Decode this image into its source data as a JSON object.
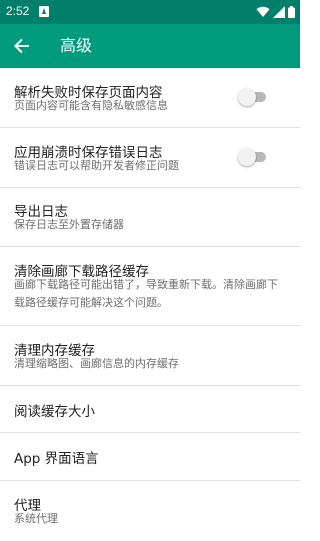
{
  "status_bar": {
    "time": "2:52",
    "icons": [
      "notification-a-icon",
      "wifi-icon",
      "cell-signal-icon",
      "battery-icon"
    ]
  },
  "app_bar": {
    "back_icon": "arrow-left-icon",
    "title": "高级"
  },
  "items": [
    {
      "title": "解析失败时保存页面内容",
      "subtitle": "页面内容可能含有隐私敏感信息",
      "toggle": false
    },
    {
      "title": "应用崩溃时保存错误日志",
      "subtitle": "错误日志可以帮助开发者修正问题",
      "toggle": false
    },
    {
      "title": "导出日志",
      "subtitle": "保存日志至外置存储器"
    },
    {
      "title": "清除画廊下载路径缓存",
      "subtitle": "画廊下载路径可能出错了，导致重新下载。清除画廊下载路径缓存可能解决这个问题。"
    },
    {
      "title": "清理内存缓存",
      "subtitle": "清理缩略图、画廊信息的内存缓存"
    },
    {
      "title": "阅读缓存大小"
    },
    {
      "title": "App 界面语言"
    },
    {
      "title": "代理",
      "subtitle": "系统代理"
    }
  ],
  "colors": {
    "status_bar": "#00806a",
    "app_bar": "#009a7d",
    "divider": "#e0e0e0",
    "toggle_track_off": "#b8b8b8",
    "toggle_thumb_off": "#f2f2f2"
  }
}
